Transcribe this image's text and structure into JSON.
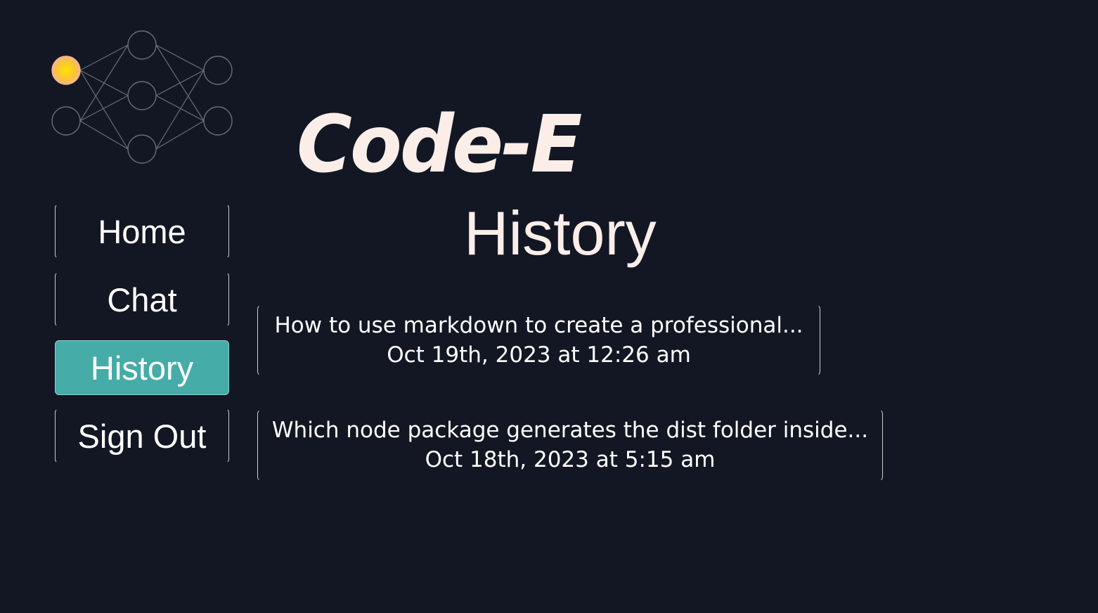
{
  "brand": {
    "name": "Code-E",
    "logo_icon": "neural-network-icon",
    "accent_node_color": "#f5c33b"
  },
  "page": {
    "title": "History"
  },
  "nav": {
    "items": [
      {
        "label": "Home",
        "active": false
      },
      {
        "label": "Chat",
        "active": false
      },
      {
        "label": "History",
        "active": true
      },
      {
        "label": "Sign Out",
        "active": false
      }
    ],
    "active_color": "#45aca7"
  },
  "history": {
    "entries": [
      {
        "title": "How to use markdown to create a professional...",
        "timestamp": "Oct 19th, 2023 at 12:26 am"
      },
      {
        "title": "Which node package generates the dist folder inside...",
        "timestamp": "Oct 18th, 2023 at 5:15 am"
      }
    ]
  },
  "colors": {
    "background": "#121723",
    "text": "#fbeee9"
  }
}
